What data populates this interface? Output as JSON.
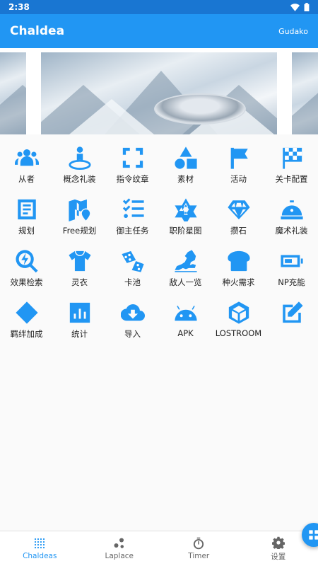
{
  "status_bar": {
    "time": "2:38"
  },
  "app_bar": {
    "title": "Chaldea",
    "user": "Gudako"
  },
  "grid": [
    [
      {
        "label": "从者",
        "icon": "users-icon"
      },
      {
        "label": "概念礼装",
        "icon": "person-pin-icon"
      },
      {
        "label": "指令纹章",
        "icon": "crop-free-icon"
      },
      {
        "label": "素材",
        "icon": "shapes-icon"
      },
      {
        "label": "活动",
        "icon": "flag-icon"
      },
      {
        "label": "关卡配置",
        "icon": "checkered-flag-icon"
      }
    ],
    [
      {
        "label": "规划",
        "icon": "article-icon"
      },
      {
        "label": "Free规划",
        "icon": "map-pin-icon"
      },
      {
        "label": "御主任务",
        "icon": "checklist-icon"
      },
      {
        "label": "职阶星图",
        "icon": "star-of-david-icon"
      },
      {
        "label": "攒石",
        "icon": "gem-icon"
      },
      {
        "label": "魔术礼装",
        "icon": "reception-bell-icon"
      }
    ],
    [
      {
        "label": "效果检索",
        "icon": "search-bolt-icon"
      },
      {
        "label": "灵衣",
        "icon": "shirt-icon"
      },
      {
        "label": "卡池",
        "icon": "dice-icon"
      },
      {
        "label": "敌人一览",
        "icon": "dragon-icon"
      },
      {
        "label": "种火需求",
        "icon": "bread-icon"
      },
      {
        "label": "NP充能",
        "icon": "battery-icon"
      }
    ],
    [
      {
        "label": "羁绊加成",
        "icon": "diamond-icon"
      },
      {
        "label": "统计",
        "icon": "bar-chart-icon"
      },
      {
        "label": "导入",
        "icon": "cloud-download-icon"
      },
      {
        "label": "APK",
        "icon": "android-icon"
      },
      {
        "label": "LOSTROOM",
        "icon": "unity-icon"
      },
      {
        "label": "",
        "icon": "edit-icon"
      }
    ]
  ],
  "bottom_nav": [
    {
      "label": "Chaldeas",
      "icon": "grid-dots-icon",
      "active": true
    },
    {
      "label": "Laplace",
      "icon": "molecule-icon",
      "active": false
    },
    {
      "label": "Timer",
      "icon": "timer-icon",
      "active": false
    },
    {
      "label": "设置",
      "icon": "gear-icon",
      "active": false
    }
  ],
  "colors": {
    "primary": "#2196f3",
    "status_bar": "#1976d2"
  }
}
